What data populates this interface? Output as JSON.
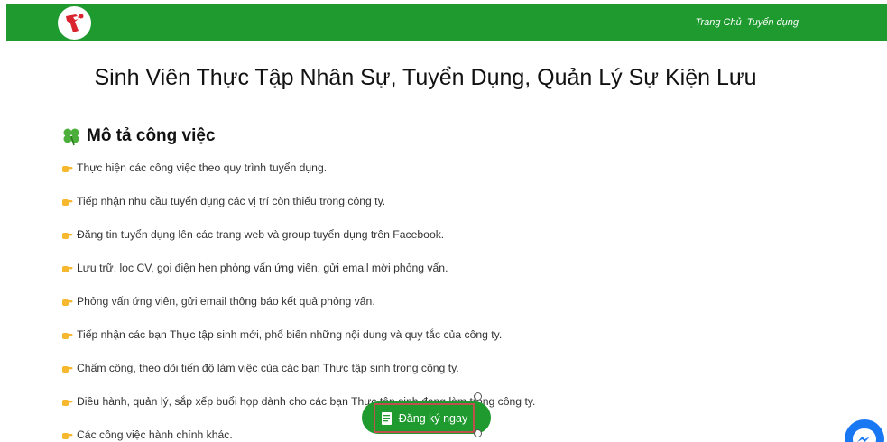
{
  "header": {
    "nav": [
      {
        "label": "Trang Chủ"
      },
      {
        "label": "Tuyển dụng"
      }
    ]
  },
  "title": "Sinh Viên Thực Tập Nhân Sự, Tuyển Dụng, Quản Lý Sự Kiện Lưu",
  "section": {
    "heading": "Mô tả công việc",
    "icon": "four-leaf-clover-icon",
    "bullet_icon": "pointing-hand-icon",
    "items": [
      "Thực hiện các công việc theo quy trình tuyển dụng.",
      "Tiếp nhận nhu cầu tuyển dụng các vị trí còn thiếu trong công ty.",
      "Đăng tin tuyển dụng lên các trang web và group tuyển dụng trên Facebook.",
      "Lưu trữ, lọc CV, gọi điện hẹn phỏng vấn ứng viên, gửi email mời phỏng vấn.",
      "Phỏng vấn ứng viên, gửi email thông báo kết quả phỏng vấn.",
      "Tiếp nhận các bạn Thực tập sinh mới, phổ biến những nội dung và quy tắc của công ty.",
      "Chấm công, theo dõi tiến độ làm việc của các bạn Thực tập sinh trong công ty.",
      "Điều hành, quản lý, sắp xếp buổi họp dành cho các bạn Thực tập sinh đang làm trong công ty.",
      "Các công việc hành chính khác."
    ]
  },
  "register_button": {
    "label": "Đăng ký ngay",
    "icon": "form-icon"
  },
  "colors": {
    "brand_green": "#1e9a2f",
    "messenger_blue": "#1877f2",
    "selection_outline": "#c0504d"
  }
}
